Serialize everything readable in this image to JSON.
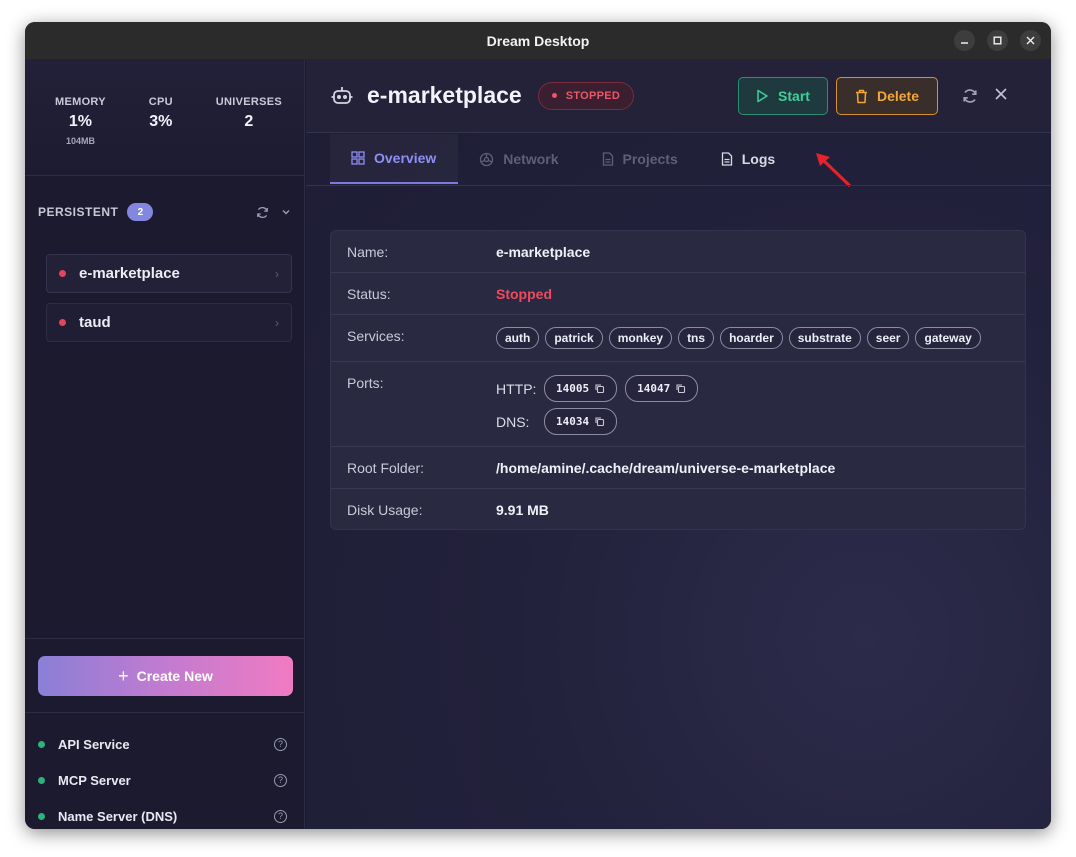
{
  "window": {
    "title": "Dream Desktop"
  },
  "stats": [
    {
      "label": "MEMORY",
      "value": "1%",
      "sub": "104MB"
    },
    {
      "label": "CPU",
      "value": "3%",
      "sub": ""
    },
    {
      "label": "UNIVERSES",
      "value": "2",
      "sub": ""
    }
  ],
  "sidebar": {
    "section_title": "PERSISTENT",
    "count": "2",
    "universes": [
      {
        "name": "e-marketplace",
        "status_color": "#e2455c"
      },
      {
        "name": "taud",
        "status_color": "#e2455c"
      }
    ],
    "create_label": "Create New",
    "services": [
      {
        "name": "API Service",
        "status_color": "#2bb37a"
      },
      {
        "name": "MCP Server",
        "status_color": "#2bb37a"
      },
      {
        "name": "Name Server (DNS)",
        "status_color": "#2bb37a"
      }
    ]
  },
  "header": {
    "title": "e-marketplace",
    "status": "STOPPED",
    "start_label": "Start",
    "delete_label": "Delete"
  },
  "tabs": [
    {
      "label": "Overview",
      "icon": "grid-icon",
      "state": "active"
    },
    {
      "label": "Network",
      "icon": "network-icon",
      "state": "disabled"
    },
    {
      "label": "Projects",
      "icon": "file-icon",
      "state": "disabled"
    },
    {
      "label": "Logs",
      "icon": "document-icon",
      "state": "enabled"
    }
  ],
  "details": {
    "name_label": "Name:",
    "name_value": "e-marketplace",
    "status_label": "Status:",
    "status_value": "Stopped",
    "services_label": "Services:",
    "services": [
      "auth",
      "patrick",
      "monkey",
      "tns",
      "hoarder",
      "substrate",
      "seer",
      "gateway"
    ],
    "ports_label": "Ports:",
    "http_label": "HTTP:",
    "http_ports": [
      "14005",
      "14047"
    ],
    "dns_label": "DNS:",
    "dns_ports": [
      "14034"
    ],
    "root_label": "Root Folder:",
    "root_value": "/home/amine/.cache/dream/universe-e-marketplace",
    "disk_label": "Disk Usage:",
    "disk_value": "9.91 MB"
  },
  "colors": {
    "accent": "#7b79e0",
    "stopped": "#ef4a5c",
    "start": "#3fcf9c",
    "delete": "#f5a638",
    "annotation_arrow": "#e8222a"
  }
}
